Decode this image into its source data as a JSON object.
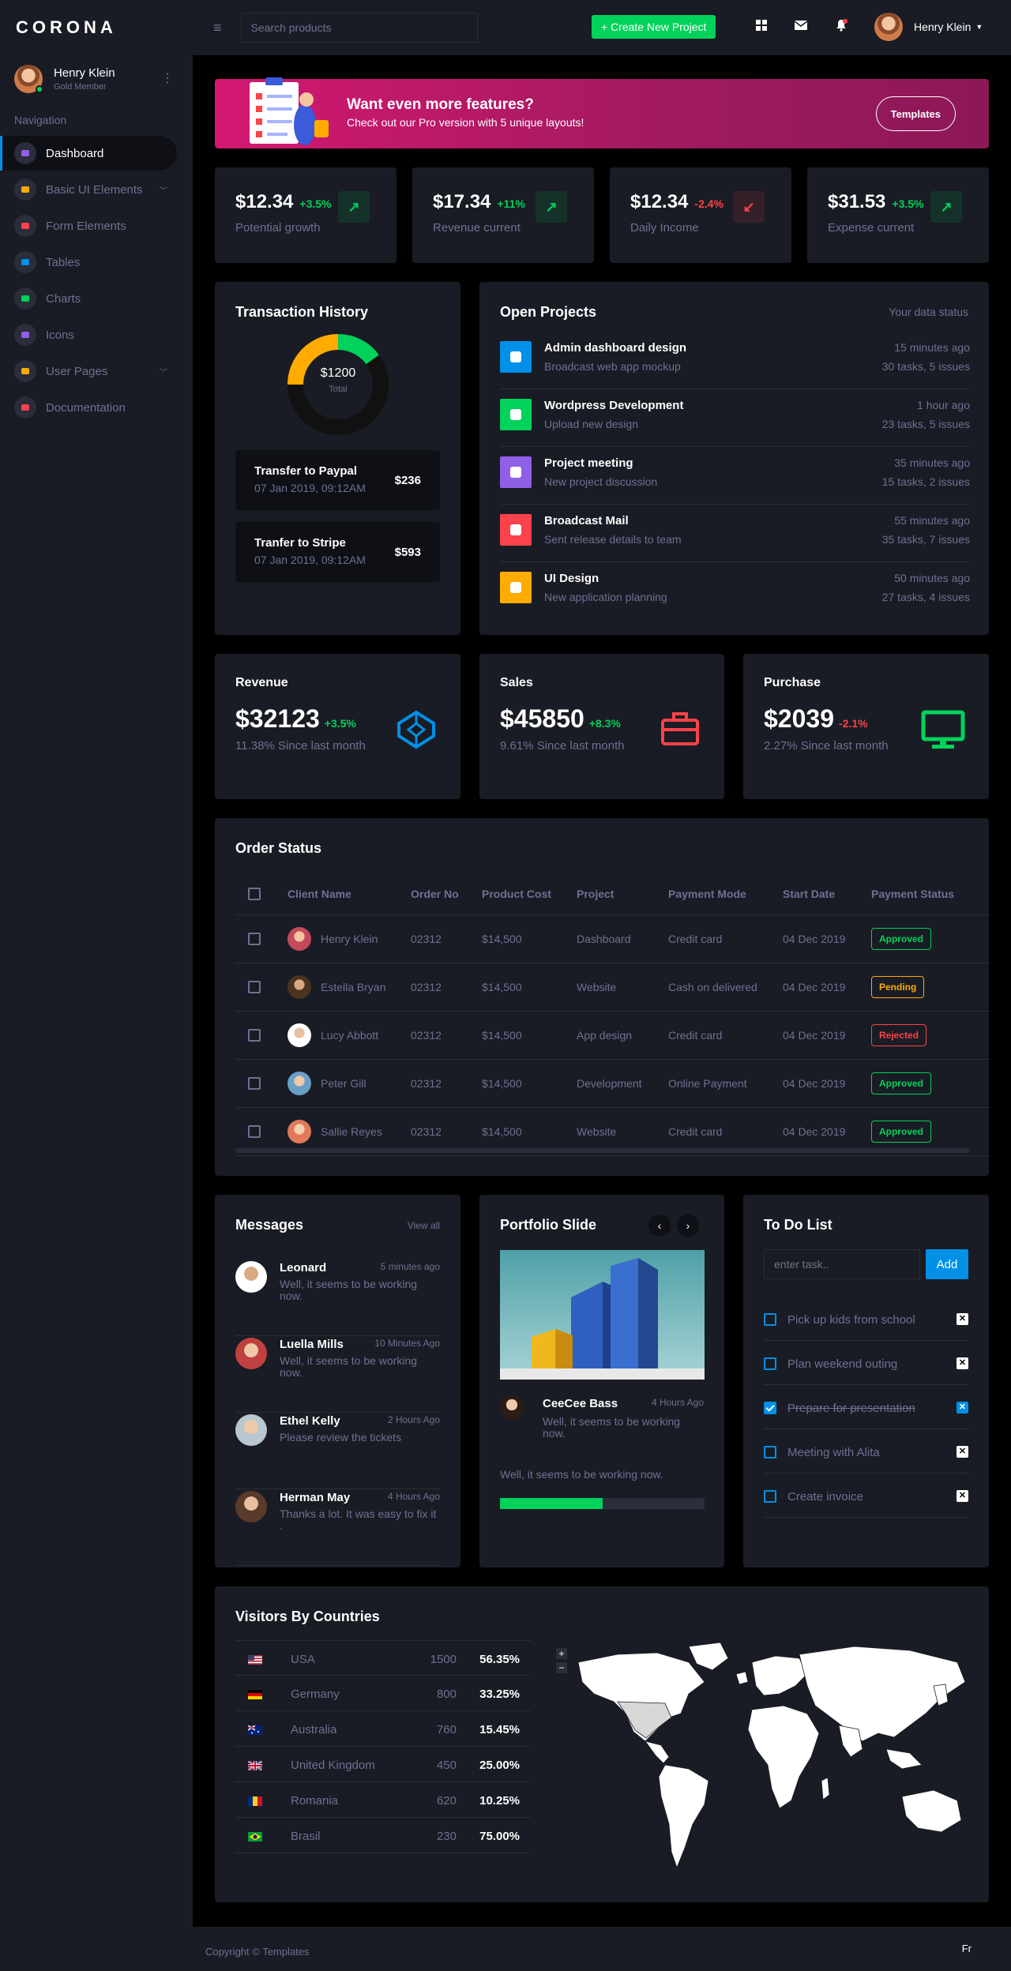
{
  "brand": "CORONA",
  "profile": {
    "name": "Henry Klein",
    "role": "Gold Member"
  },
  "nav_title": "Navigation",
  "nav": [
    {
      "label": "Dashboard",
      "icon": "speedometer-icon",
      "color": "#8f5fe8",
      "active": true
    },
    {
      "label": "Basic UI Elements",
      "icon": "laptop-icon",
      "color": "#ffab00",
      "chevron": true
    },
    {
      "label": "Form Elements",
      "icon": "playlist-icon",
      "color": "#fc424a"
    },
    {
      "label": "Tables",
      "icon": "table-icon",
      "color": "#0090e7"
    },
    {
      "label": "Charts",
      "icon": "chart-icon",
      "color": "#00d25b"
    },
    {
      "label": "Icons",
      "icon": "contacts-icon",
      "color": "#8f5fe8"
    },
    {
      "label": "User Pages",
      "icon": "security-icon",
      "color": "#ffab00",
      "chevron": true
    },
    {
      "label": "Documentation",
      "icon": "file-icon",
      "color": "#fc424a"
    }
  ],
  "topbar": {
    "search_placeholder": "Search products",
    "create_label": "+ Create New Project",
    "user_name": "Henry Klein"
  },
  "banner": {
    "title": "Want even more features?",
    "subtitle": "Check out our Pro version with 5 unique layouts!",
    "button": "Templates"
  },
  "stats": [
    {
      "value": "$12.34",
      "pct": "+3.5%",
      "label": "Potential growth",
      "up": true
    },
    {
      "value": "$17.34",
      "pct": "+11%",
      "label": "Revenue current",
      "up": true
    },
    {
      "value": "$12.34",
      "pct": "-2.4%",
      "label": "Daily Income",
      "up": false
    },
    {
      "value": "$31.53",
      "pct": "+3.5%",
      "label": "Expense current",
      "up": true
    }
  ],
  "transaction": {
    "title": "Transaction History",
    "donut_value": "$1200",
    "donut_label": "Total",
    "donut_segments": [
      {
        "fraction": 0.25,
        "color": "#ffab00"
      },
      {
        "fraction": 0.15,
        "color": "#00d25b"
      },
      {
        "fraction": 0.6,
        "color": "#111111"
      }
    ],
    "items": [
      {
        "title": "Transfer to Paypal",
        "date": "07 Jan 2019, 09:12AM",
        "amount": "$236"
      },
      {
        "title": "Tranfer to Stripe",
        "date": "07 Jan 2019, 09:12AM",
        "amount": "$593"
      }
    ]
  },
  "projects": {
    "title": "Open Projects",
    "status": "Your data status",
    "items": [
      {
        "title": "Admin dashboard design",
        "sub": "Broadcast web app mockup",
        "time": "15 minutes ago",
        "tasks": "30 tasks, 5 issues",
        "color": "#0090e7",
        "icon": "file-icon"
      },
      {
        "title": "Wordpress Development",
        "sub": "Upload new design",
        "time": "1 hour ago",
        "tasks": "23 tasks, 5 issues",
        "color": "#00d25b",
        "icon": "cloud-upload-icon"
      },
      {
        "title": "Project meeting",
        "sub": "New project discussion",
        "time": "35 minutes ago",
        "tasks": "15 tasks, 2 issues",
        "color": "#8f5fe8",
        "icon": "clock-icon"
      },
      {
        "title": "Broadcast Mail",
        "sub": "Sent release details to team",
        "time": "55 minutes ago",
        "tasks": "35 tasks, 7 issues",
        "color": "#fc424a",
        "icon": "mail-icon"
      },
      {
        "title": "UI Design",
        "sub": "New application planning",
        "time": "50 minutes ago",
        "tasks": "27 tasks, 4 issues",
        "color": "#ffab00",
        "icon": "chart-pie-icon"
      }
    ]
  },
  "minis": [
    {
      "title": "Revenue",
      "value": "$32123",
      "pct": "+3.5%",
      "sub": "11.38% Since last month",
      "up": true,
      "icon": "codepen-icon",
      "color": "#0090e7"
    },
    {
      "title": "Sales",
      "value": "$45850",
      "pct": "+8.3%",
      "sub": "9.61% Since last month",
      "up": true,
      "icon": "briefcase-icon",
      "color": "#fc424a"
    },
    {
      "title": "Purchase",
      "value": "$2039",
      "pct": "-2.1%",
      "sub": "2.27% Since last month",
      "up": false,
      "icon": "monitor-icon",
      "color": "#00d25b"
    }
  ],
  "orders": {
    "title": "Order Status",
    "headers": [
      "Client Name",
      "Order No",
      "Product Cost",
      "Project",
      "Payment Mode",
      "Start Date",
      "Payment Status"
    ],
    "rows": [
      {
        "client": "Henry Klein",
        "order": "02312",
        "cost": "$14,500",
        "project": "Dashboard",
        "mode": "Credit card",
        "date": "04 Dec 2019",
        "status": "Approved",
        "status_color": "#00d25b"
      },
      {
        "client": "Estella Bryan",
        "order": "02312",
        "cost": "$14,500",
        "project": "Website",
        "mode": "Cash on delivered",
        "date": "04 Dec 2019",
        "status": "Pending",
        "status_color": "#ffab00"
      },
      {
        "client": "Lucy Abbott",
        "order": "02312",
        "cost": "$14,500",
        "project": "App design",
        "mode": "Credit card",
        "date": "04 Dec 2019",
        "status": "Rejected",
        "status_color": "#fc424a"
      },
      {
        "client": "Peter Gill",
        "order": "02312",
        "cost": "$14,500",
        "project": "Development",
        "mode": "Online Payment",
        "date": "04 Dec 2019",
        "status": "Approved",
        "status_color": "#00d25b"
      },
      {
        "client": "Sallie Reyes",
        "order": "02312",
        "cost": "$14,500",
        "project": "Website",
        "mode": "Credit card",
        "date": "04 Dec 2019",
        "status": "Approved",
        "status_color": "#00d25b"
      }
    ]
  },
  "messages": {
    "title": "Messages",
    "view_all": "View all",
    "items": [
      {
        "name": "Leonard",
        "time": "5 minutes ago",
        "text": "Well, it seems to be working now."
      },
      {
        "name": "Luella Mills",
        "time": "10 Minutes Ago",
        "text": "Well, it seems to be working now."
      },
      {
        "name": "Ethel Kelly",
        "time": "2 Hours Ago",
        "text": "Please review the tickets"
      },
      {
        "name": "Herman May",
        "time": "4 Hours Ago",
        "text": "Thanks a lot. It was easy to fix it ."
      }
    ]
  },
  "portfolio": {
    "title": "Portfolio Slide",
    "author": "CeeCee Bass",
    "time": "4 Hours Ago",
    "text": "Well, it seems to be working now.",
    "caption": "Well, it seems to be working now.",
    "progress": 0.5
  },
  "todo": {
    "title": "To Do List",
    "placeholder": "enter task..",
    "add": "Add",
    "items": [
      {
        "text": "Pick up kids from school",
        "done": false
      },
      {
        "text": "Plan weekend outing",
        "done": false
      },
      {
        "text": "Prepare for presentation",
        "done": true
      },
      {
        "text": "Meeting with Alita",
        "done": false
      },
      {
        "text": "Create invoice",
        "done": false
      }
    ]
  },
  "visitors": {
    "title": "Visitors By Countries",
    "rows": [
      {
        "country": "USA",
        "count": "1500",
        "pct": "56.35%",
        "flag": "flag-us"
      },
      {
        "country": "Germany",
        "count": "800",
        "pct": "33.25%",
        "flag": "flag-de"
      },
      {
        "country": "Australia",
        "count": "760",
        "pct": "15.45%",
        "flag": "flag-au"
      },
      {
        "country": "United Kingdom",
        "count": "450",
        "pct": "25.00%",
        "flag": "flag-gb"
      },
      {
        "country": "Romania",
        "count": "620",
        "pct": "10.25%",
        "flag": "flag-ro"
      },
      {
        "country": "Brasil",
        "count": "230",
        "pct": "75.00%",
        "flag": "flag-br"
      }
    ],
    "zoom_in": "+",
    "zoom_out": "−"
  },
  "footer": {
    "copyright": "Copyright © Templates",
    "right": "Fr"
  }
}
